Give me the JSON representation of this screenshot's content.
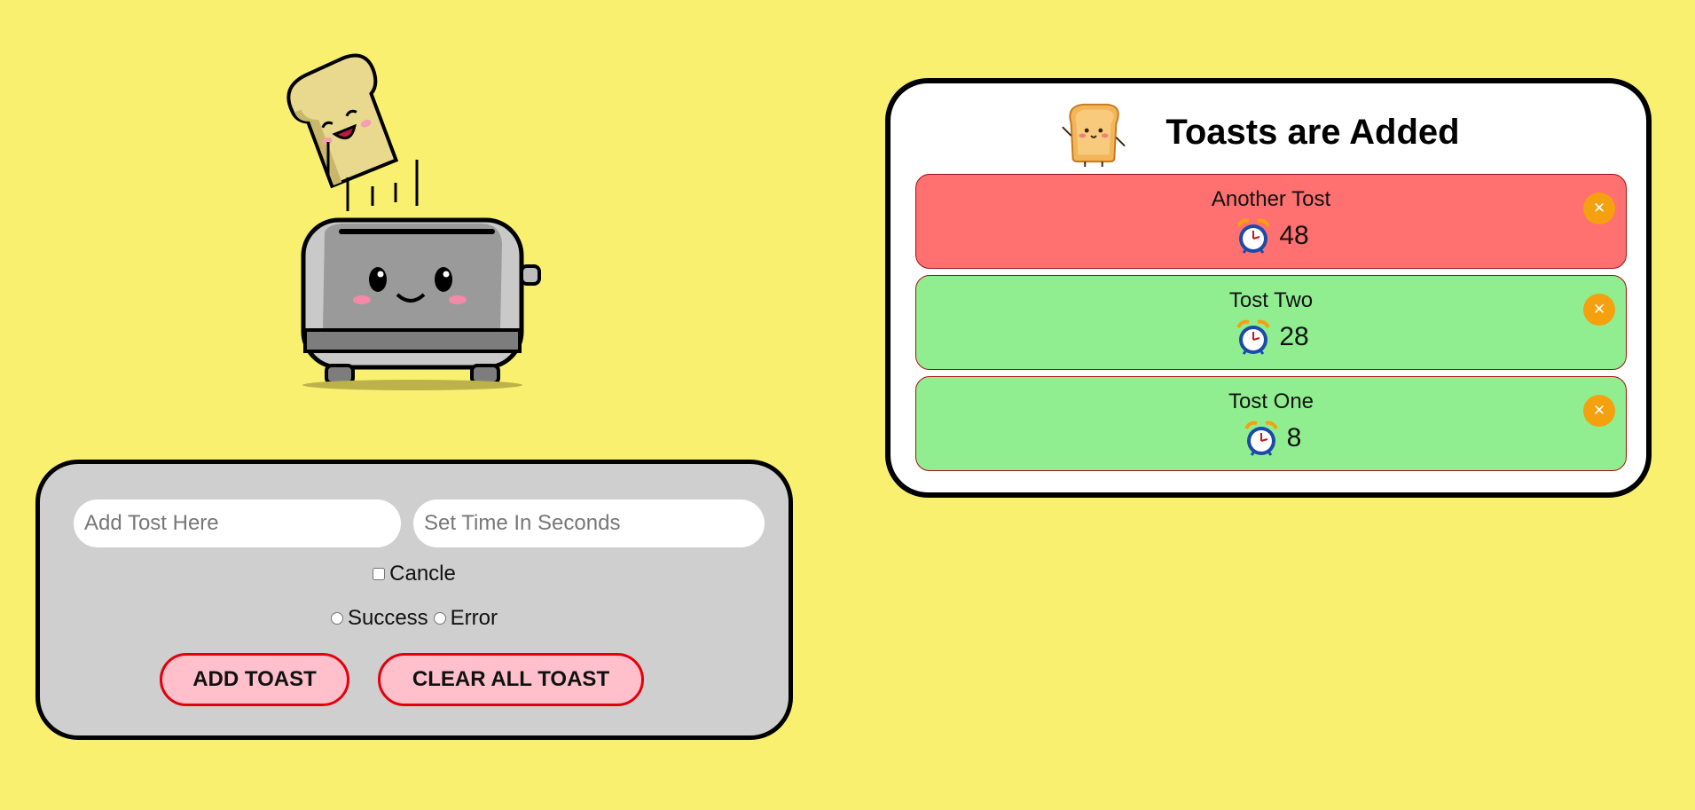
{
  "form": {
    "tost_input_placeholder": "Add Tost Here",
    "time_input_placeholder": "Set Time In Seconds",
    "cancel_label": "Cancle",
    "success_label": "Success",
    "error_label": "Error",
    "add_button_label": "ADD TOAST",
    "clear_button_label": "CLEAR ALL TOAST"
  },
  "toast_panel": {
    "title": "Toasts are Added",
    "toasts": [
      {
        "name": "Another Tost",
        "seconds": "48",
        "status": "error"
      },
      {
        "name": "Tost Two",
        "seconds": "28",
        "status": "success"
      },
      {
        "name": "Tost One",
        "seconds": "8",
        "status": "success"
      }
    ]
  },
  "icons": {
    "illustration": "toaster-with-toast-icon",
    "mascot": "toast-mascot-icon",
    "timer": "alarm-clock-icon",
    "close": "close-icon"
  },
  "colors": {
    "page_background": "#f9f06f",
    "error_toast": "#ff7070",
    "success_toast": "#90ee90",
    "close_button": "#f5a00f",
    "button_fill": "#ffc0cb",
    "button_border": "#e3000b"
  }
}
